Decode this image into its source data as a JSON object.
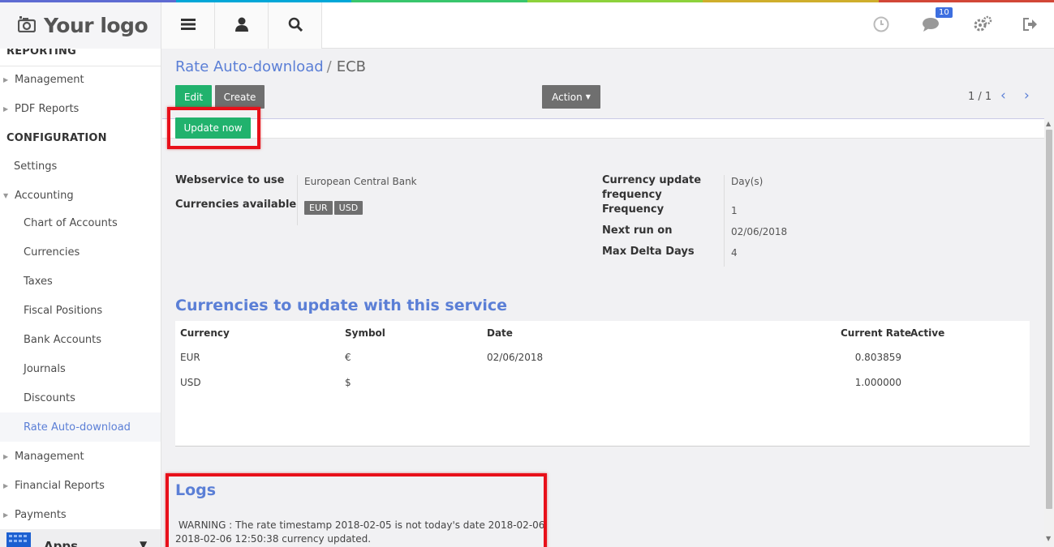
{
  "colors": {
    "topbar_segments": [
      "#5e6bd2",
      "#00a7d8",
      "#39c66d",
      "#8dd23c",
      "#cfae2c",
      "#d24737"
    ],
    "accent": "#5b7fd6",
    "primary_button": "#21b26d",
    "secondary_button": "#6f6f6f",
    "highlight_box": "#e8101a"
  },
  "header": {
    "logo_text": "Your logo",
    "menu_icon": "hamburger-icon",
    "user_icon": "user-icon",
    "search_icon": "search-icon",
    "clock_icon": "clock-icon",
    "chat_icon": "chat-icon",
    "chat_badge": "10",
    "settings_icon": "gears-icon",
    "logout_icon": "logout-icon"
  },
  "sidebar": {
    "items": [
      {
        "label": "REPORTING",
        "level": "head"
      },
      {
        "label": "Management",
        "level": "top",
        "caret": "right"
      },
      {
        "label": "PDF Reports",
        "level": "top",
        "caret": "right"
      },
      {
        "label": "CONFIGURATION",
        "level": "head"
      },
      {
        "label": "Settings",
        "level": "top"
      },
      {
        "label": "Accounting",
        "level": "top",
        "caret": "down"
      },
      {
        "label": "Chart of Accounts",
        "level": "sub"
      },
      {
        "label": "Currencies",
        "level": "sub"
      },
      {
        "label": "Taxes",
        "level": "sub"
      },
      {
        "label": "Fiscal Positions",
        "level": "sub"
      },
      {
        "label": "Bank Accounts",
        "level": "sub"
      },
      {
        "label": "Journals",
        "level": "sub"
      },
      {
        "label": "Discounts",
        "level": "sub"
      },
      {
        "label": "Rate Auto-download",
        "level": "sub",
        "active": true
      },
      {
        "label": "Management",
        "level": "top",
        "caret": "right"
      },
      {
        "label": "Financial Reports",
        "level": "top",
        "caret": "right"
      },
      {
        "label": "Payments",
        "level": "top",
        "caret": "right"
      }
    ],
    "apps_label": "Apps"
  },
  "breadcrumb": {
    "parent": "Rate Auto-download",
    "separator": "/",
    "current": "ECB"
  },
  "buttons": {
    "edit": "Edit",
    "create": "Create",
    "action": "Action",
    "update_now": "Update now"
  },
  "pager": {
    "text": "1 / 1"
  },
  "form": {
    "webservice_label": "Webservice to use",
    "webservice_value": "European Central Bank",
    "currencies_label": "Currencies available",
    "currencies_tags": [
      "EUR",
      "USD"
    ],
    "frequency_label_1": "Currency update",
    "frequency_label_2": "frequency",
    "frequency_unit": "Day(s)",
    "freq_label": "Frequency",
    "freq_value": "1",
    "next_run_label": "Next run on",
    "next_run_value": "02/06/2018",
    "max_delta_label": "Max Delta Days",
    "max_delta_value": "4"
  },
  "currencies_section": {
    "title": "Currencies to update with this service",
    "columns": [
      "Currency",
      "Symbol",
      "Date",
      "Current Rate",
      "Active"
    ],
    "rows": [
      {
        "currency": "EUR",
        "symbol": "€",
        "date": "02/06/2018",
        "rate": "0.803859"
      },
      {
        "currency": "USD",
        "symbol": "$",
        "date": "",
        "rate": "1.000000"
      }
    ]
  },
  "logs": {
    "title": "Logs",
    "lines": [
      " WARNING : The rate timestamp 2018-02-05 is not today's date 2018-02-06",
      "2018-02-06 12:50:38 currency updated."
    ]
  }
}
